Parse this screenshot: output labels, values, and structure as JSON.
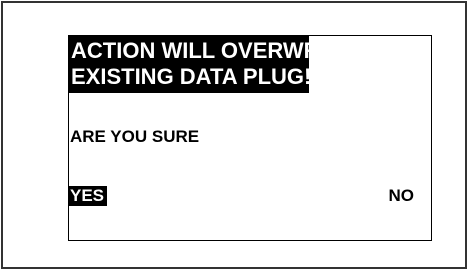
{
  "dialog": {
    "title_line1": "ACTION WILL OVERWRITE",
    "title_line2": "EXISTING DATA PLUG!!",
    "question": "ARE YOU SURE",
    "yes_label": "YES",
    "no_label": "NO"
  },
  "colors": {
    "background": "#ffffff",
    "title_bg": "#000000",
    "title_text": "#ffffff",
    "selected_bg": "#000000",
    "text": "#000000"
  }
}
